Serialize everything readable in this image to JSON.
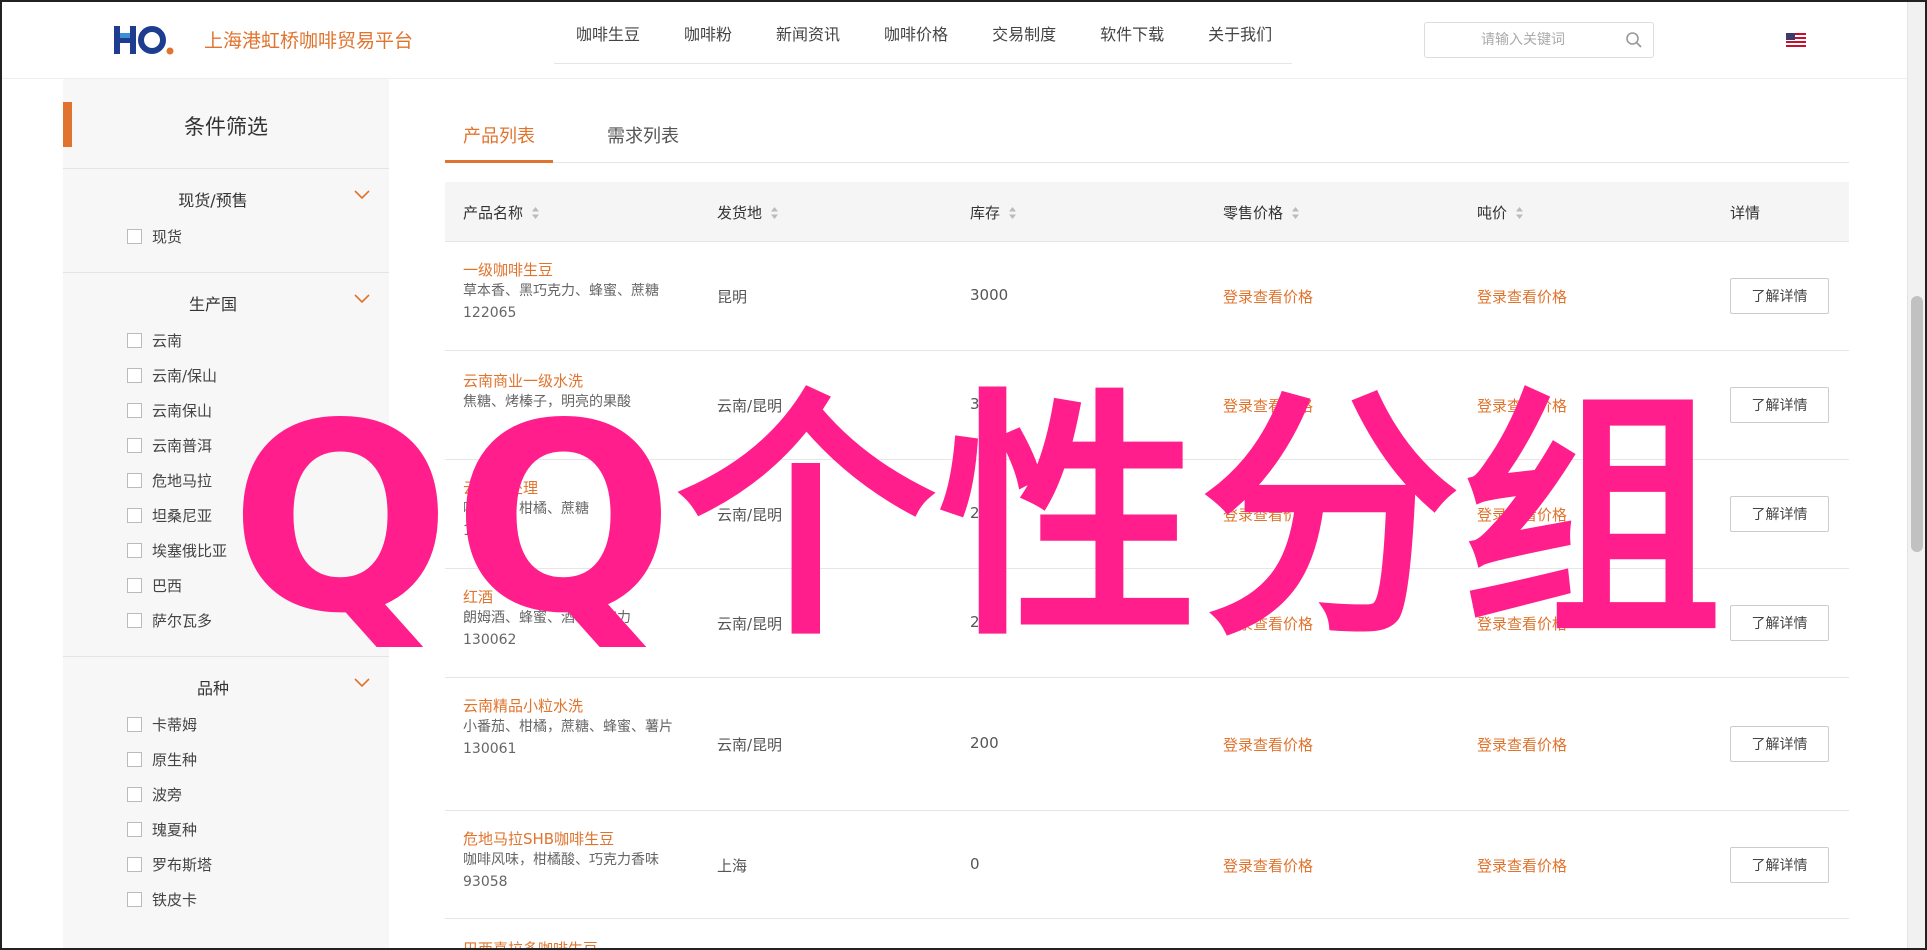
{
  "header": {
    "site_name": "上海港虹桥咖啡贸易平台",
    "logo_text": "HO.",
    "nav": [
      "咖啡生豆",
      "咖啡粉",
      "新闻资讯",
      "咖啡价格",
      "交易制度",
      "软件下载",
      "关于我们"
    ],
    "search_placeholder": "请输入关键词"
  },
  "sidebar": {
    "title": "条件筛选",
    "groups": [
      {
        "title": "现货/预售",
        "options": [
          "现货"
        ]
      },
      {
        "title": "生产国",
        "options": [
          "云南",
          "云南/保山",
          "云南保山",
          "云南普洱",
          "危地马拉",
          "坦桑尼亚",
          "埃塞俄比亚",
          "巴西",
          "萨尔瓦多"
        ]
      },
      {
        "title": "品种",
        "options": [
          "卡蒂姆",
          "原生种",
          "波旁",
          "瑰夏种",
          "罗布斯塔",
          "铁皮卡"
        ]
      }
    ]
  },
  "tabs": [
    "产品列表",
    "需求列表"
  ],
  "table": {
    "columns": [
      "产品名称",
      "发货地",
      "库存",
      "零售价格",
      "吨价",
      "详情"
    ],
    "rows": [
      {
        "name": "一级咖啡生豆",
        "desc": "草本香、黑巧克力、蜂蜜、蔗糖",
        "code": "122065",
        "origin": "昆明",
        "stock": "3000",
        "retail": "登录查看价格",
        "ton": "登录查看价格",
        "detail": "了解详情"
      },
      {
        "name": "云南商业一级水洗",
        "desc": "焦糖、烤榛子，明亮的果酸",
        "code": "",
        "origin": "云南/昆明",
        "stock": "300",
        "retail": "登录查看价格",
        "ton": "登录查看价格",
        "detail": "了解详情"
      },
      {
        "name": "云南蜜处理",
        "desc": "咖啡花、柑橘、蔗糖",
        "code": "130063",
        "origin": "云南/昆明",
        "stock": "200",
        "retail": "登录查看价格",
        "ton": "登录查看价格",
        "detail": "了解详情"
      },
      {
        "name": "红酒",
        "desc": "朗姆酒、蜂蜜、酒心巧克力",
        "code": "130062",
        "origin": "云南/昆明",
        "stock": "200",
        "retail": "登录查看价格",
        "ton": "登录查看价格",
        "detail": "了解详情"
      },
      {
        "name": "云南精品小粒水洗",
        "desc": "小番茄、柑橘，蔗糖、蜂蜜、薯片",
        "code": "130061",
        "origin": "云南/昆明",
        "stock": "200",
        "retail": "登录查看价格",
        "ton": "登录查看价格",
        "detail": "了解详情"
      },
      {
        "name": "危地马拉SHB咖啡生豆",
        "desc": "咖啡风味，柑橘酸、巧克力香味",
        "code": "93058",
        "origin": "上海",
        "stock": "0",
        "retail": "登录查看价格",
        "ton": "登录查看价格",
        "detail": "了解详情"
      },
      {
        "name": "巴西喜拉多咖啡生豆",
        "desc": "",
        "code": "",
        "origin": "",
        "stock": "",
        "retail": "",
        "ton": "",
        "detail": ""
      }
    ]
  },
  "watermark": "QQ个性分组",
  "colors": {
    "accent": "#e0742e",
    "watermark": "#ff1e8c"
  }
}
